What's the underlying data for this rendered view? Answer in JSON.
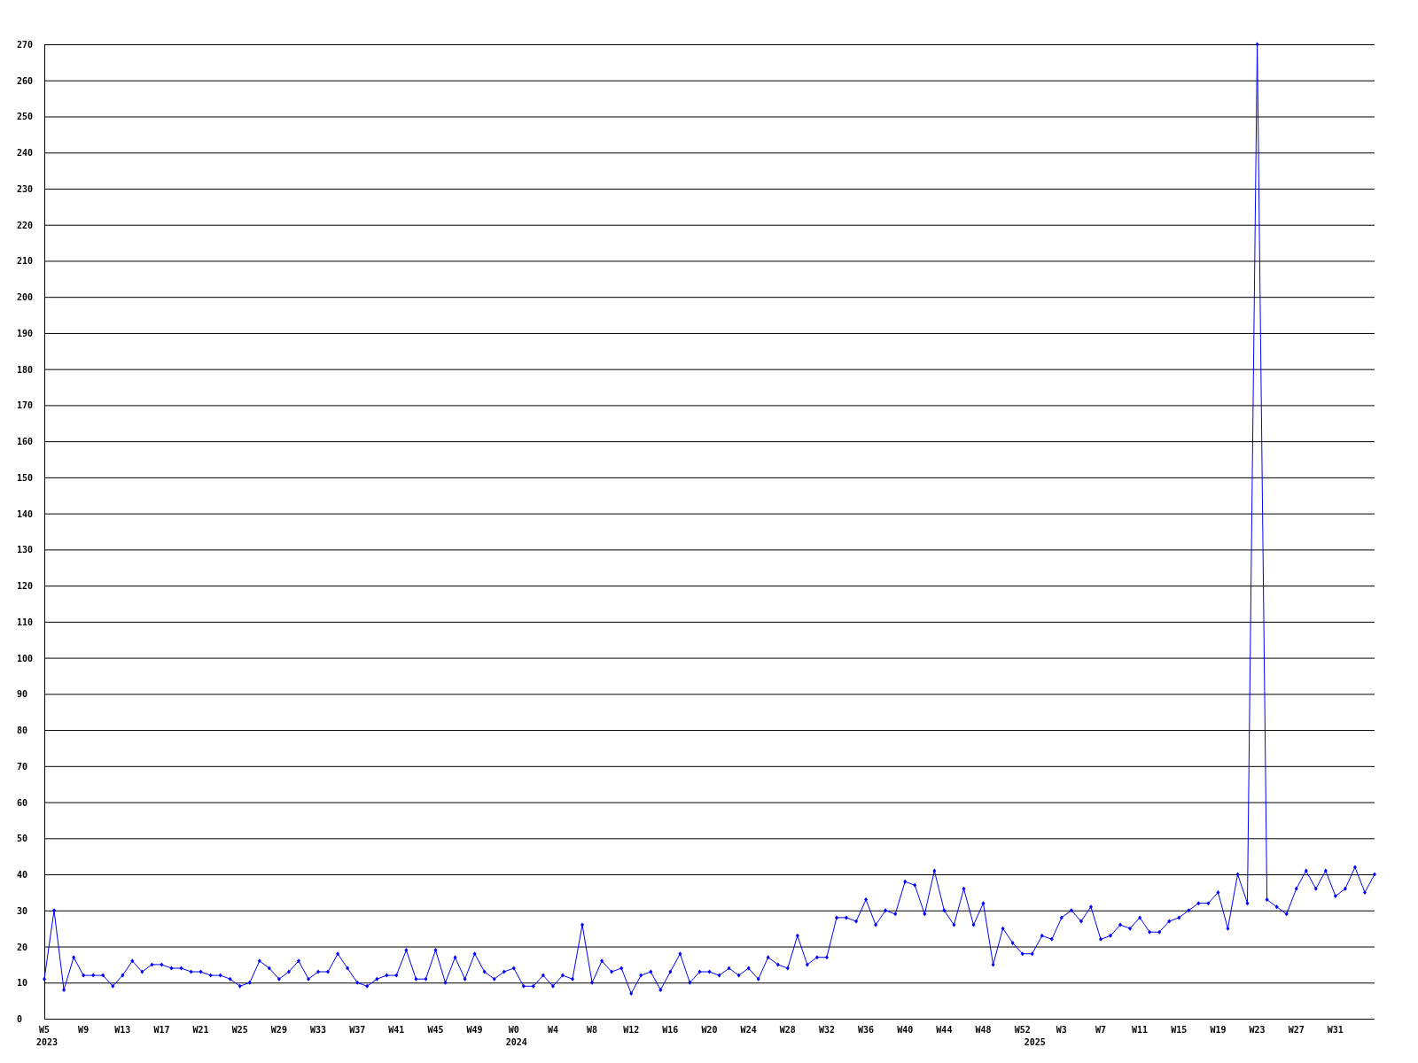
{
  "chart": {
    "chart_data": {
      "type": "line",
      "grid": true,
      "categories": [
        "W5",
        null,
        null,
        null,
        "W9",
        null,
        null,
        null,
        "W13",
        null,
        null,
        null,
        "W17",
        null,
        null,
        null,
        "W21",
        null,
        null,
        null,
        "W25",
        null,
        null,
        null,
        "W29",
        null,
        null,
        null,
        "W33",
        null,
        null,
        null,
        "W37",
        null,
        null,
        null,
        "W41",
        null,
        null,
        null,
        "W45",
        null,
        null,
        null,
        "W49",
        null,
        null,
        null,
        "W0",
        null,
        null,
        null,
        "W4",
        null,
        null,
        null,
        "W8",
        null,
        null,
        null,
        "W12",
        null,
        null,
        null,
        "W16",
        null,
        null,
        null,
        "W20",
        null,
        null,
        null,
        "W24",
        null,
        null,
        null,
        "W28",
        null,
        null,
        null,
        "W32",
        null,
        null,
        null,
        "W36",
        null,
        null,
        null,
        "W40",
        null,
        null,
        null,
        "W44",
        null,
        null,
        null,
        "W48",
        null,
        null,
        null,
        "W52",
        null,
        null,
        null,
        "W3",
        null,
        null,
        null,
        "W7",
        null,
        null,
        null,
        "W11",
        null,
        null,
        null,
        "W15",
        null,
        null,
        null,
        "W19",
        null,
        null,
        null,
        "W23",
        null,
        null,
        null,
        "W27",
        null,
        null,
        null,
        "W31",
        null,
        null,
        null,
        null
      ],
      "series": [
        {
          "color": "#0000ff",
          "marker": "diamond",
          "values": [
            11,
            30,
            8,
            17,
            12,
            12,
            12,
            9,
            12,
            16,
            13,
            15,
            15,
            14,
            14,
            13,
            13,
            12,
            12,
            11,
            9,
            10,
            16,
            14,
            11,
            13,
            16,
            11,
            13,
            13,
            18,
            14,
            10,
            9,
            11,
            12,
            12,
            19,
            11,
            11,
            19,
            10,
            17,
            11,
            18,
            13,
            11,
            13,
            14,
            9,
            9,
            12,
            9,
            12,
            11,
            26,
            10,
            16,
            13,
            14,
            7,
            12,
            13,
            8,
            13,
            18,
            10,
            13,
            13,
            12,
            14,
            12,
            14,
            11,
            17,
            15,
            14,
            23,
            15,
            17,
            17,
            28,
            28,
            27,
            33,
            26,
            30,
            29,
            38,
            37,
            29,
            41,
            30,
            26,
            36,
            26,
            32,
            15,
            25,
            21,
            18,
            18,
            23,
            22,
            28,
            30,
            27,
            31,
            22,
            23,
            26,
            25,
            28,
            24,
            24,
            27,
            28,
            30,
            32,
            32,
            35,
            25,
            40,
            32,
            270,
            33,
            31,
            29,
            36,
            41,
            36,
            41,
            34,
            36,
            42,
            35,
            40
          ]
        }
      ],
      "ylim": [
        0,
        270
      ],
      "yticks": [
        0,
        10,
        20,
        30,
        40,
        50,
        60,
        70,
        80,
        90,
        100,
        110,
        120,
        130,
        140,
        150,
        160,
        170,
        180,
        190,
        200,
        210,
        220,
        230,
        240,
        250,
        260,
        270
      ],
      "annotations": [
        "2023",
        "2024",
        "2025"
      ]
    }
  }
}
